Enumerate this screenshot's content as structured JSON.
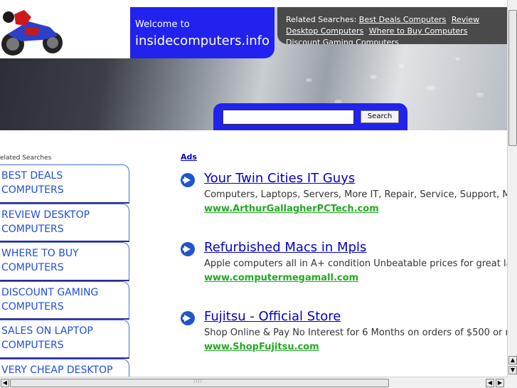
{
  "header": {
    "welcome_line": "Welcome to",
    "site_name": "insidecomputers.info",
    "related_prefix": "Related Searches:",
    "related_links": [
      "Best Deals Computers",
      "Review Desktop Computers",
      "Where to Buy Computers",
      "Discount Gaming Computers"
    ]
  },
  "search": {
    "input_value": "",
    "button_label": "Search"
  },
  "sidebar": {
    "label": "elated Searches",
    "items": [
      {
        "line1": "BEST DEALS",
        "line2": "COMPUTERS"
      },
      {
        "line1": "REVIEW DESKTOP",
        "line2": "COMPUTERS"
      },
      {
        "line1": "WHERE TO BUY",
        "line2": "COMPUTERS"
      },
      {
        "line1": "DISCOUNT GAMING",
        "line2": "COMPUTERS"
      },
      {
        "line1": "SALES ON LAPTOP",
        "line2": "COMPUTERS"
      },
      {
        "line1": "VERY CHEAP DESKTOP",
        "line2": ""
      }
    ]
  },
  "ads": {
    "label": "Ads",
    "items": [
      {
        "title": "Your Twin Cities IT Guys",
        "desc": "Computers, Laptops, Servers, More IT, Repair, Service, Support, M",
        "url": "www.ArthurGallagherPCTech.com"
      },
      {
        "title": "Refurbished Macs in Mpls",
        "desc": "Apple computers all in A+ condition Unbeatable prices for great lap",
        "url": "www.computermegamall.com"
      },
      {
        "title": "Fujitsu - Official Store",
        "desc": "Shop Online & Pay No Interest for 6 Months on orders of $500 or m",
        "url": "www.ShopFujitsu.com"
      }
    ]
  },
  "colors": {
    "brand_blue": "#2222ee",
    "link_blue": "#0000cc",
    "url_green": "#22aa22",
    "dark_panel": "#4a4a4a"
  },
  "icons": {
    "ad_bullet": "arrow-circle-icon",
    "logo": "motorcycle-icon"
  }
}
